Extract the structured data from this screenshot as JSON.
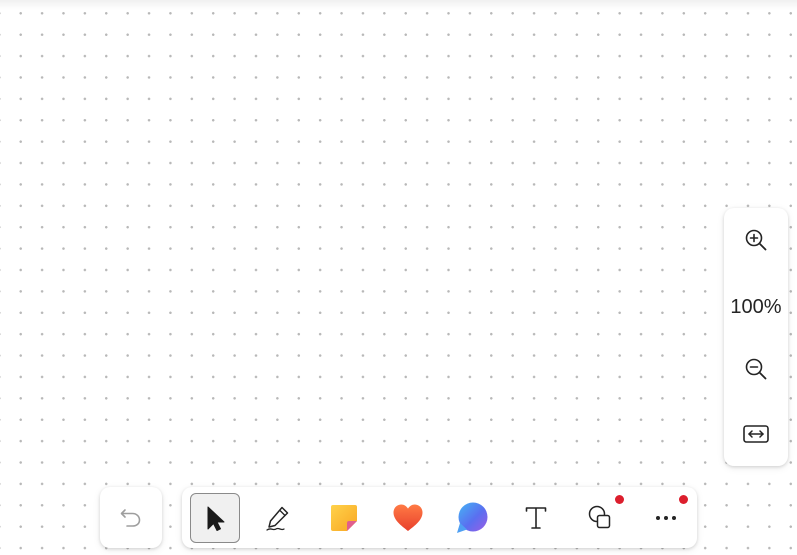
{
  "canvas": {
    "background": "#ffffff",
    "dot_color": "#b8b8b8"
  },
  "zoom_controls": {
    "zoom_in_icon": "zoom-in-icon",
    "zoom_level": "100%",
    "zoom_out_icon": "zoom-out-icon",
    "fit_icon": "fit-to-screen-icon"
  },
  "toolbar": {
    "undo_icon": "undo-icon",
    "tools": [
      {
        "id": "select",
        "icon": "pointer-icon",
        "selected": true,
        "badge": false
      },
      {
        "id": "pen",
        "icon": "pen-icon",
        "selected": false,
        "badge": false
      },
      {
        "id": "sticky-note",
        "icon": "sticky-note-icon",
        "selected": false,
        "badge": false,
        "color": "#fdbf2d"
      },
      {
        "id": "reactions",
        "icon": "heart-icon",
        "selected": false,
        "badge": false,
        "color": "#f2553a"
      },
      {
        "id": "comment",
        "icon": "comment-bubble-icon",
        "selected": false,
        "badge": false,
        "color": "#5b7df5"
      },
      {
        "id": "text",
        "icon": "text-icon",
        "selected": false,
        "badge": false
      },
      {
        "id": "shapes",
        "icon": "shapes-icon",
        "selected": false,
        "badge": true
      },
      {
        "id": "more",
        "icon": "more-icon",
        "selected": false,
        "badge": true
      }
    ],
    "badge_color": "#dc1e2d",
    "selected_border": "#8a8a8a"
  }
}
